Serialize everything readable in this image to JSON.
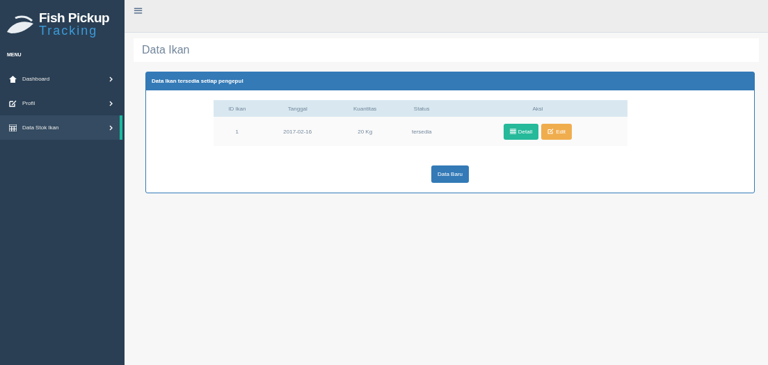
{
  "brand": {
    "line1": "Fish Pickup",
    "line2": "Tracking"
  },
  "sidebar": {
    "heading": "MENU",
    "items": [
      {
        "label": "Dashboard",
        "kind": "home",
        "selected": false
      },
      {
        "label": "Profil",
        "kind": "edit",
        "selected": false
      },
      {
        "label": "Data Stok Ikan",
        "kind": "table",
        "selected": true
      }
    ]
  },
  "topbar": {
    "menu_icon": "≡"
  },
  "page_title": "Data Ikan",
  "panel": {
    "title": "Data Ikan tersedia setiap pengepul",
    "table": {
      "columns": [
        "ID Ikan",
        "Tanggal",
        "Kuantitas",
        "Status",
        "Aksi"
      ],
      "rows": [
        {
          "cells": [
            "1",
            "2017-02-16",
            "20 Kg",
            "tersedia"
          ],
          "actions": [
            {
              "kind": "detail",
              "label": "Detail"
            },
            {
              "kind": "edit",
              "label": "Edit"
            }
          ]
        }
      ]
    },
    "button": "Data Baru"
  }
}
